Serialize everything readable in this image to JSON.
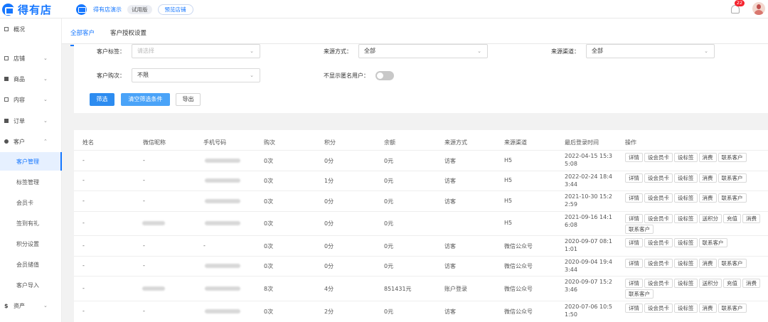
{
  "brand": {
    "name": "得有店"
  },
  "store": {
    "name": "得有店演示",
    "plan": "试用版",
    "preview": "预览店铺"
  },
  "notifications": {
    "count": "22"
  },
  "sidebar": {
    "items": [
      {
        "label": "概况",
        "icon": "grid-icon"
      },
      {
        "label": "店铺",
        "icon": "store-icon"
      },
      {
        "label": "商品",
        "icon": "goods-icon"
      },
      {
        "label": "内容",
        "icon": "content-icon"
      },
      {
        "label": "订单",
        "icon": "order-icon"
      },
      {
        "label": "客户",
        "icon": "customer-icon"
      },
      {
        "label": "资产",
        "icon": "dollar-icon"
      }
    ],
    "sub_items": [
      "客户管理",
      "标签管理",
      "会员卡",
      "签到有礼",
      "积分设置",
      "会员储值",
      "客户导入"
    ]
  },
  "tabs": [
    "全部客户",
    "客户授权设置"
  ],
  "filter": {
    "tag_label": "客户标签：",
    "tag_placeholder": "请选择",
    "source_label": "来源方式：",
    "source_value": "全部",
    "channel_label": "来源渠道：",
    "channel_value": "全部",
    "times_label": "客户购次：",
    "times_value": "不限",
    "anon_label": "不显示匿名用户：",
    "btn_filter": "筛选",
    "btn_clear": "清空筛选条件",
    "btn_export": "导出"
  },
  "table": {
    "columns": [
      "姓名",
      "微信昵称",
      "手机号码",
      "购次",
      "积分",
      "余额",
      "来源方式",
      "来源渠道",
      "最后登录时间",
      "操作"
    ],
    "rows": [
      {
        "name": "-",
        "nick": "-",
        "phone": "",
        "times": "0次",
        "points": "0分",
        "balance": "0元",
        "source": "访客",
        "channel": "H5",
        "time": "2022-04-15 15:35:08",
        "ops": [
          "详情",
          "设会员卡",
          "设标签",
          "消费",
          "联系客户"
        ]
      },
      {
        "name": "-",
        "nick": "-",
        "phone": "",
        "times": "0次",
        "points": "1分",
        "balance": "0元",
        "source": "访客",
        "channel": "H5",
        "time": "2022-02-24 18:43:44",
        "ops": [
          "详情",
          "设会员卡",
          "设标签",
          "消费",
          "联系客户"
        ]
      },
      {
        "name": "-",
        "nick": "-",
        "phone": "",
        "times": "0次",
        "points": "0分",
        "balance": "0元",
        "source": "访客",
        "channel": "H5",
        "time": "2021-10-30 15:22:59",
        "ops": [
          "详情",
          "设会员卡",
          "设标签",
          "消费",
          "联系客户"
        ]
      },
      {
        "name": "-",
        "nick": "",
        "phone": "",
        "times": "0次",
        "points": "0分",
        "balance": "0元",
        "source": "",
        "channel": "H5",
        "time": "2021-09-16 14:16:08",
        "ops": [
          "详情",
          "设会员卡",
          "设标签",
          "送积分",
          "充值",
          "消费",
          "联系客户"
        ]
      },
      {
        "name": "-",
        "nick": "-",
        "phone": "-",
        "times": "0次",
        "points": "0分",
        "balance": "0元",
        "source": "访客",
        "channel": "微信公众号",
        "time": "2020-09-07 08:11:01",
        "ops": [
          "详情",
          "设会员卡",
          "设标签",
          "联系客户"
        ]
      },
      {
        "name": "-",
        "nick": "-",
        "phone": "",
        "times": "0次",
        "points": "0分",
        "balance": "0元",
        "source": "访客",
        "channel": "微信公众号",
        "time": "2020-09-04 19:43:44",
        "ops": [
          "详情",
          "设会员卡",
          "设标签",
          "消费",
          "联系客户"
        ]
      },
      {
        "name": "-",
        "nick": "",
        "phone": "",
        "times": "8次",
        "points": "4分",
        "balance": "851431元",
        "source": "账户登录",
        "channel": "微信公众号",
        "time": "2020-09-07 15:23:46",
        "ops": [
          "详情",
          "设会员卡",
          "设标签",
          "送积分",
          "充值",
          "消费",
          "联系客户"
        ]
      },
      {
        "name": "-",
        "nick": "-",
        "phone": "",
        "times": "0次",
        "points": "2分",
        "balance": "0元",
        "source": "访客",
        "channel": "微信公众号",
        "time": "2020-07-06 10:51:50",
        "ops": [
          "详情",
          "设会员卡",
          "设标签",
          "消费",
          "联系客户"
        ]
      }
    ]
  },
  "colors": {
    "primary": "#1677ff",
    "active_bg": "#e6f0ff",
    "badge": "#f5222d"
  }
}
